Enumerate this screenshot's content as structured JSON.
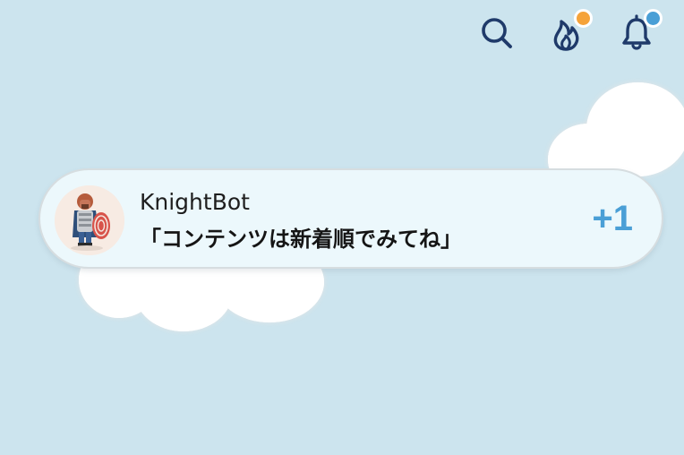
{
  "header": {
    "icons": [
      {
        "name": "search-icon"
      },
      {
        "name": "fire-icon",
        "badge_color": "#f5a33a"
      },
      {
        "name": "bell-icon",
        "badge_color": "#4a9fd6"
      }
    ],
    "icon_color": "#1f3a6a"
  },
  "notification": {
    "sender": "KnightBot",
    "message": "「コンテンツは新着順でみてね」",
    "count": "+1",
    "avatar_icon": "knight-avatar-icon"
  },
  "colors": {
    "background": "#cce4ee",
    "card": "#ecf8fc",
    "accent": "#4a9fd6"
  }
}
